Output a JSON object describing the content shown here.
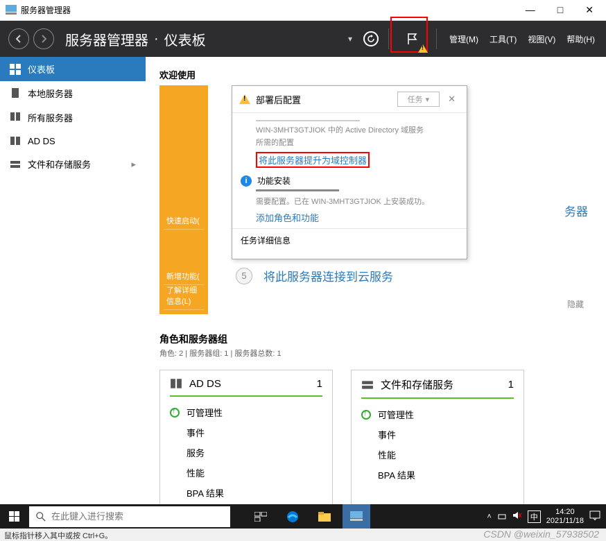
{
  "window": {
    "title": "服务器管理器",
    "minimize": "—",
    "maximize": "□",
    "close": "✕"
  },
  "header": {
    "breadcrumb1": "服务器管理器",
    "sep": "·",
    "breadcrumb2": "仪表板",
    "dropdown": "▾",
    "menus": {
      "manage": "管理(M)",
      "tools": "工具(T)",
      "view": "视图(V)",
      "help": "帮助(H)"
    }
  },
  "sidebar": {
    "items": [
      {
        "icon": "dashboard-icon",
        "label": "仪表板"
      },
      {
        "icon": "server-icon",
        "label": "本地服务器"
      },
      {
        "icon": "servers-icon",
        "label": "所有服务器"
      },
      {
        "icon": "adds-icon",
        "label": "AD DS"
      },
      {
        "icon": "storage-icon",
        "label": "文件和存储服务",
        "chevron": "▸"
      }
    ]
  },
  "content": {
    "welcome": "欢迎使用",
    "quick": {
      "start": "快速启动(",
      "new": "新增功能(",
      "learn": "了解详细信息(L)"
    },
    "step5_num": "5",
    "step5_label": "将此服务器连接到云服务",
    "right_text": "务器",
    "hide": "隐藏"
  },
  "notif": {
    "title": "部署后配置",
    "task_btn": "任务",
    "task_arrow": "▾",
    "close": "✕",
    "line1": "WIN-3MHT3GTJIOK 中的 Active Directory 域服务",
    "line2": "所需的配置",
    "promote_link": "将此服务器提升为域控制器",
    "feature_title": "功能安装",
    "feature_status": "需要配置。已在 WIN-3MHT3GTJIOK 上安装成功。",
    "add_roles_link": "添加角色和功能",
    "task_details": "任务详细信息"
  },
  "roles": {
    "title": "角色和服务器组",
    "subtitle": "角色: 2 | 服务器组: 1 | 服务器总数: 1",
    "cards": [
      {
        "icon": "adds-icon",
        "title": "AD DS",
        "count": "1",
        "rows": [
          "可管理性",
          "事件",
          "服务",
          "性能",
          "BPA 结果"
        ]
      },
      {
        "icon": "storage-icon",
        "title": "文件和存储服务",
        "count": "1",
        "rows": [
          "可管理性",
          "事件",
          "性能",
          "BPA 结果"
        ]
      }
    ]
  },
  "taskbar": {
    "search_placeholder": "在此键入进行搜索",
    "ime": "中",
    "time": "14:20",
    "date": "2021/11/18"
  },
  "statusbar": {
    "text": "鼠标指针移入其中或按 Ctrl+G。"
  },
  "watermark": "CSDN @weixin_57938502"
}
